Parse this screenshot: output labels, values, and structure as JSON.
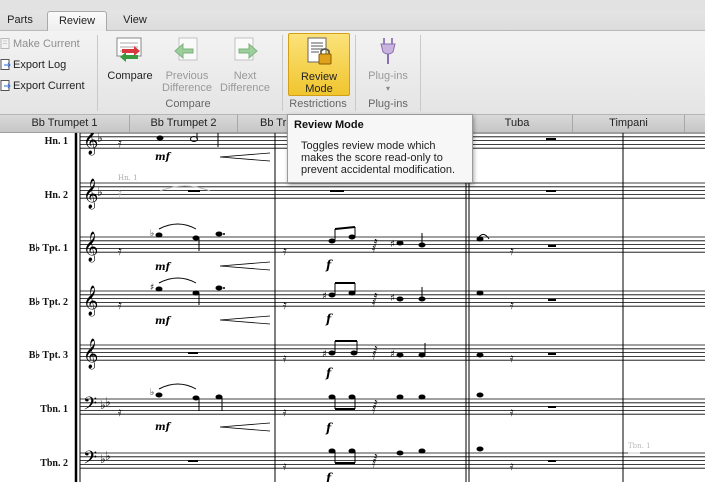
{
  "tabs": [
    {
      "label": "Parts"
    },
    {
      "label": "Review"
    },
    {
      "label": "View"
    }
  ],
  "ribbon": {
    "small_commands": [
      {
        "label": "Make Current",
        "enabled": false
      },
      {
        "label": "Export Log",
        "enabled": true
      },
      {
        "label": "Export Current",
        "enabled": true
      }
    ],
    "compare_group": {
      "label": "Compare",
      "compare": "Compare",
      "previous_difference": [
        "Previous",
        "Difference"
      ],
      "next_difference": [
        "Next",
        "Difference"
      ]
    },
    "restrictions_group": {
      "label": "Restrictions",
      "review_mode": [
        "Review",
        "Mode"
      ]
    },
    "plugins_group": {
      "label": "Plug-ins",
      "plugins": "Plug-ins"
    }
  },
  "part_tabs": [
    "Bb Trumpet 1",
    "Bb Trumpet 2",
    "Bb Tr",
    "Tuba",
    "Timpani"
  ],
  "staves": [
    {
      "label": "Hn. 1",
      "clef": "treble"
    },
    {
      "label": "Hn. 2",
      "clef": "treble"
    },
    {
      "label": "B♭ Tpt. 1",
      "clef": "treble"
    },
    {
      "label": "B♭ Tpt. 2",
      "clef": "treble"
    },
    {
      "label": "B♭ Tpt. 3",
      "clef": "treble"
    },
    {
      "label": "Tbn. 1",
      "clef": "bass"
    },
    {
      "label": "Tbn. 2",
      "clef": "bass"
    }
  ],
  "score_text": {
    "cue_hn1": "Hn. 1",
    "cue_tbn1": "Tbn. 1",
    "dyn_mf": "mf",
    "dyn_f": "f"
  },
  "tooltip": {
    "title": "Review Mode",
    "body": "Toggles review mode which makes the score read-only to prevent accidental modification."
  },
  "colors": {
    "accent_pressed": "#f0c52e",
    "ribbon_bg": "#ececec",
    "tooltip_bg": "#f7f7f7"
  }
}
